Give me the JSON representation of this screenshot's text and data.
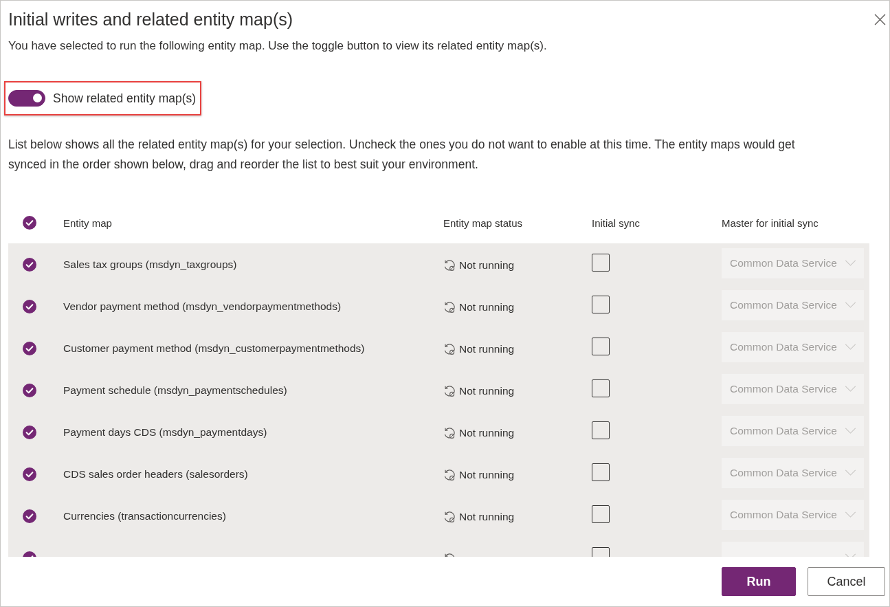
{
  "dialog": {
    "title": "Initial writes and related entity map(s)",
    "subtitle": "You have selected to run the following entity map. Use the toggle button to view its related entity map(s)."
  },
  "toggle": {
    "label": "Show related entity map(s)",
    "on": true,
    "highlighted": true
  },
  "description": "List below shows all the related entity map(s) for your selection. Uncheck the ones you do not want to enable at this time. The entity maps would get synced in the order shown below, drag and reorder the list to best suit your environment.",
  "table": {
    "select_all": {
      "checked": true
    },
    "columns": [
      "Entity map",
      "Entity map status",
      "Initial sync",
      "Master for initial sync"
    ],
    "rows": [
      {
        "checked": true,
        "entity_map": "Sales tax groups (msdyn_taxgroups)",
        "status": "Not running",
        "initial_sync": false,
        "master": "Common Data Service",
        "master_disabled": true
      },
      {
        "checked": true,
        "entity_map": "Vendor payment method (msdyn_vendorpaymentmethods)",
        "status": "Not running",
        "initial_sync": false,
        "master": "Common Data Service",
        "master_disabled": true
      },
      {
        "checked": true,
        "entity_map": "Customer payment method (msdyn_customerpaymentmethods)",
        "status": "Not running",
        "initial_sync": false,
        "master": "Common Data Service",
        "master_disabled": true
      },
      {
        "checked": true,
        "entity_map": "Payment schedule (msdyn_paymentschedules)",
        "status": "Not running",
        "initial_sync": false,
        "master": "Common Data Service",
        "master_disabled": true
      },
      {
        "checked": true,
        "entity_map": "Payment days CDS (msdyn_paymentdays)",
        "status": "Not running",
        "initial_sync": false,
        "master": "Common Data Service",
        "master_disabled": true
      },
      {
        "checked": true,
        "entity_map": "CDS sales order headers (salesorders)",
        "status": "Not running",
        "initial_sync": false,
        "master": "Common Data Service",
        "master_disabled": true
      },
      {
        "checked": true,
        "entity_map": "Currencies (transactioncurrencies)",
        "status": "Not running",
        "initial_sync": false,
        "master": "Common Data Service",
        "master_disabled": true
      },
      {
        "checked": true,
        "initial_sync": false,
        "master_disabled": true
      }
    ]
  },
  "footer": {
    "buttons": [
      {
        "label": "Run",
        "kind": "primary"
      },
      {
        "label": "Cancel",
        "kind": "default"
      }
    ]
  }
}
